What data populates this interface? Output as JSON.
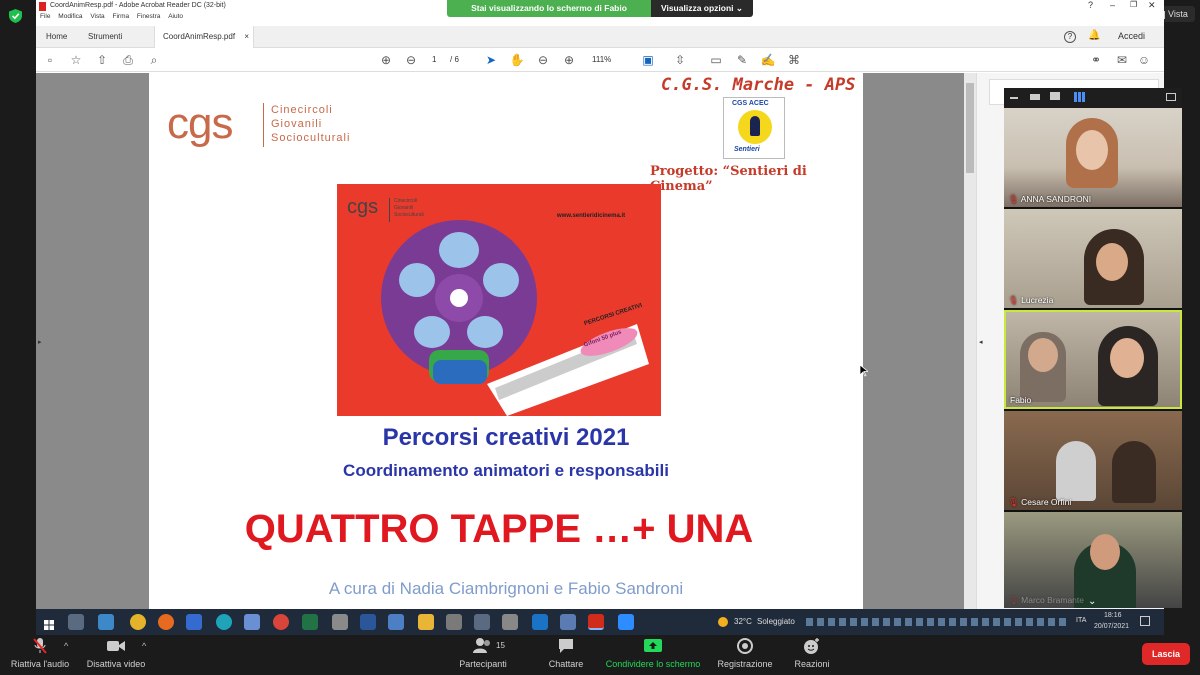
{
  "window": {
    "title": "CoordAnimResp.pdf - Adobe Acrobat Reader DC (32-bit)",
    "menu": [
      "File",
      "Modifica",
      "Vista",
      "Firma",
      "Finestra",
      "Aiuto"
    ]
  },
  "tabs": {
    "home": "Home",
    "tools": "Strumenti",
    "doc": "CoordAnimResp.pdf"
  },
  "header_right": {
    "signin": "Accedi"
  },
  "toolbar": {
    "page_current": "1",
    "page_total": "/ 6",
    "zoom": "111%"
  },
  "share_banner": {
    "message": "Stai visualizzando lo schermo di Fabio",
    "options": "Visualizza opzioni"
  },
  "view_button": "Vista",
  "pdf": {
    "org_header": "C.G.S. Marche - APS",
    "logo_text": "cgs",
    "logo_lines": [
      "Cinecircoli",
      "Giovanili",
      "Socioculturali"
    ],
    "project": "Progetto: “Sentieri di Cinema”",
    "seal_top": "CGS ACEC",
    "seal_bottom": "Sentieri",
    "poster": {
      "logo_text": "cgs",
      "logo_lines": [
        "Cinecircoli",
        "Giovanili",
        "Socioculturali"
      ],
      "url": "www.sentieridicinema.it",
      "band_text": "PERCORSI CREATIVI",
      "badge": "Gifoni 50 plus"
    },
    "title": "Percorsi creativi 2021",
    "subtitle": "Coordinamento animatori e responsabili",
    "headline": "QUATTRO TAPPE …+ UNA",
    "credits": "A cura di Nadia Ciambrignoni e Fabio Sandroni"
  },
  "participants": [
    {
      "name": "ANNA SANDRONI",
      "muted": true
    },
    {
      "name": "Lucrezia",
      "muted": true
    },
    {
      "name": "Fabio",
      "muted": false
    },
    {
      "name": "Cesare Orfini",
      "muted": true
    },
    {
      "name": "Marco Bramante",
      "muted": true
    }
  ],
  "taskbar": {
    "weather_temp": "32°C",
    "weather_text": "Soleggiato",
    "language": "ITA",
    "time": "18:16",
    "date": "20/07/2021"
  },
  "zoom_controls": {
    "audio": "Riattiva l'audio",
    "video": "Disattiva video",
    "participants": "Partecipanti",
    "participants_count": "15",
    "chat": "Chattare",
    "share": "Condividere lo schermo",
    "record": "Registrazione",
    "reactions": "Reazioni",
    "leave": "Lascia"
  },
  "colors": {
    "cgs_brand": "#c8694a",
    "pdf_title_blue": "#2a36a8",
    "pdf_headline_red": "#e01820",
    "poster_red": "#ea3a2c",
    "zoom_green": "#23d959",
    "banner_green": "#4caf50",
    "leave_red": "#e02828"
  }
}
